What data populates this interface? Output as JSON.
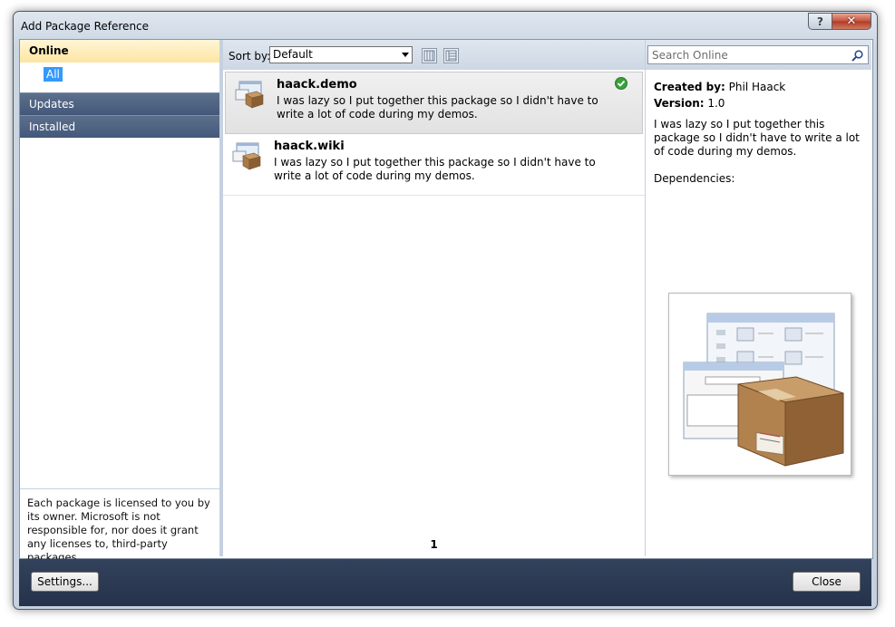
{
  "window": {
    "title": "Add Package Reference"
  },
  "titlebar_buttons": {
    "help": "?",
    "close": "✕"
  },
  "sidebar": {
    "online": "Online",
    "all": "All",
    "updates": "Updates",
    "installed": "Installed",
    "license_note": "Each package is licensed to you by its owner. Microsoft is not responsible for, nor does it grant any licenses to, third-party packages."
  },
  "toolbar": {
    "sort_label": "Sort by:",
    "sort_value": "Default"
  },
  "packages": [
    {
      "name": "haack.demo",
      "description": "I was lazy so I put together this package so I didn't have to write a lot of code during my demos.",
      "installed": true,
      "selected": true
    },
    {
      "name": "haack.wiki",
      "description": "I was lazy so I put together this package so I didn't have to write a lot of code during my demos.",
      "installed": false,
      "selected": false
    }
  ],
  "pagination": {
    "page": "1"
  },
  "search": {
    "placeholder": "Search Online"
  },
  "details": {
    "created_by_label": "Created by:",
    "created_by": "Phil Haack",
    "version_label": "Version:",
    "version": "1.0",
    "description": "I was lazy so I put together this package so I didn't have to write a lot of code during my demos.",
    "dependencies_label": "Dependencies:"
  },
  "footer": {
    "settings_label": "Settings...",
    "close_label": "Close"
  },
  "colors": {
    "accent": "#3399ff",
    "nav_bg": "#44587a",
    "footer_bg": "#25324a",
    "installed_check": "#3aa13a"
  },
  "icons": [
    "help-icon",
    "close-icon",
    "chevron-down-icon",
    "list-view-icon",
    "detail-view-icon",
    "search-icon",
    "package-icon",
    "check-icon"
  ]
}
